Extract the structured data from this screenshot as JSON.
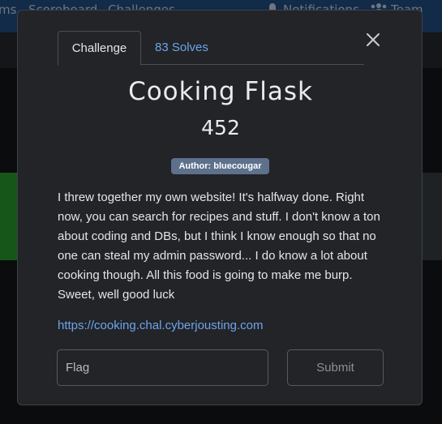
{
  "background_nav": {
    "items": [
      "ms",
      "Scoreboard",
      "Challenges",
      "Notifications",
      "Team"
    ]
  },
  "modal": {
    "tabs": [
      {
        "label": "Challenge",
        "active": true
      },
      {
        "label": "83 Solves",
        "active": false
      }
    ],
    "close_icon": "close-icon",
    "title": "Cooking Flask",
    "points": "452",
    "author_badge": "Author: bluecougar",
    "description": "I threw together my own website! It's halfway done. Right now, you can search for recipes and stuff. I don't know a ton about coding and DBs, but I think I know enough so that no one can steal my admin password... I do know a lot about cooking though. All this food is going to make me burp. Sweet, well good luck",
    "link": "https://cooking.chal.cyberjousting.com",
    "flag_input": {
      "placeholder": "Flag",
      "value": ""
    },
    "submit_label": "Submit"
  },
  "colors": {
    "accent_link": "#6ea4ea",
    "badge_bg": "#5d708c",
    "modal_bg": "#222428",
    "nav_bg": "#1f4f86"
  }
}
